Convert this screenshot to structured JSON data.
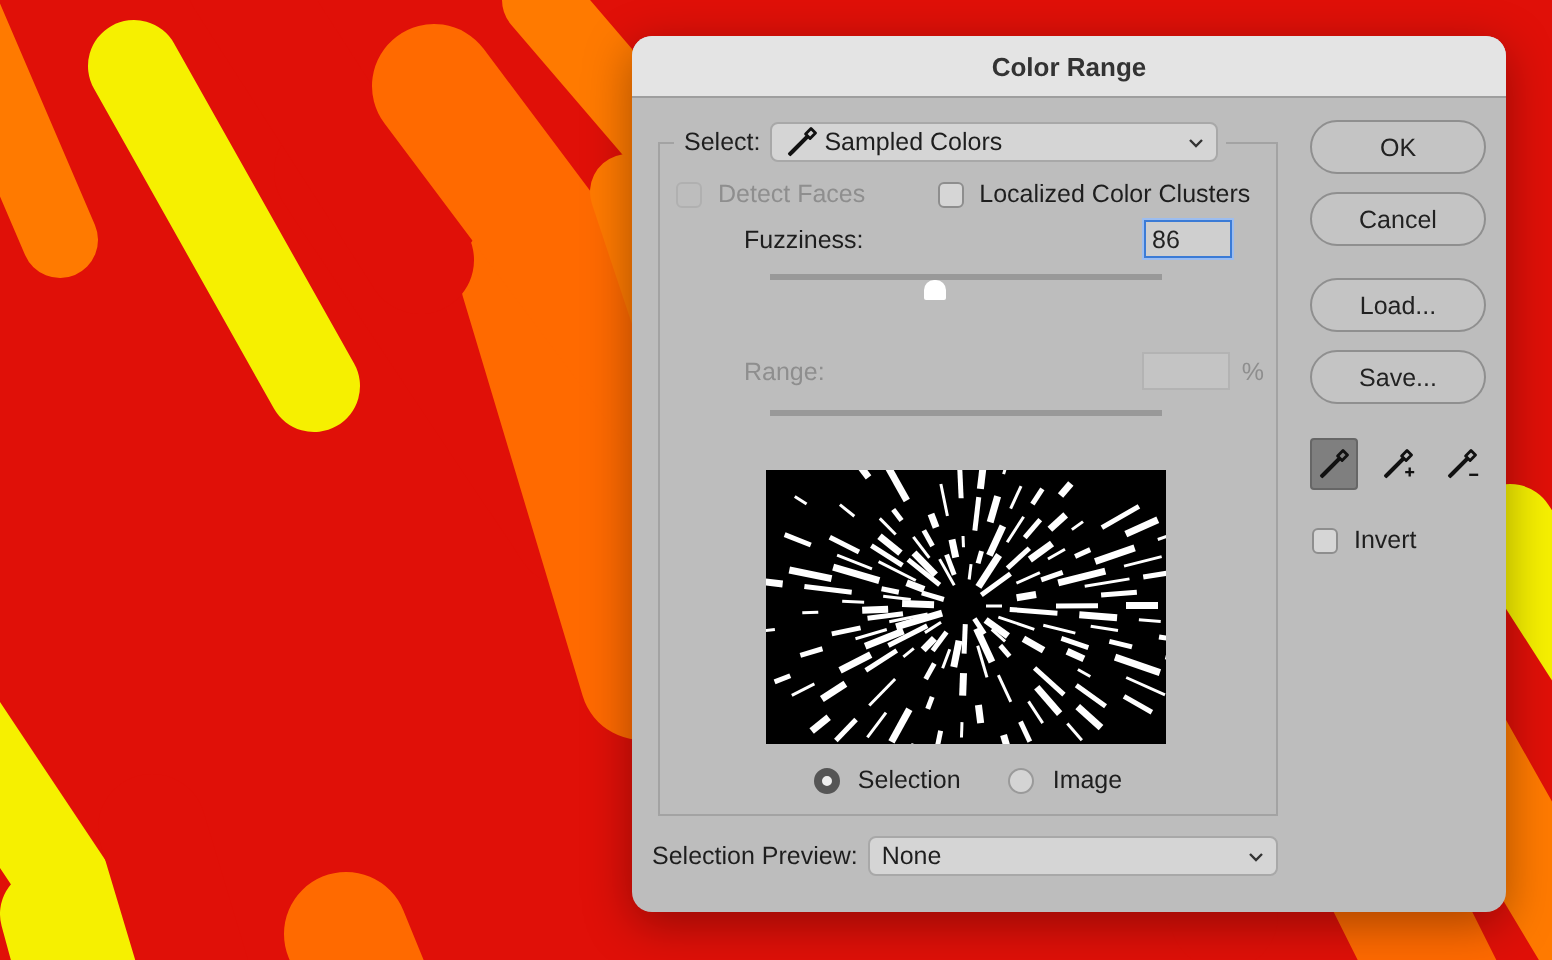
{
  "window": {
    "title": "Color Range"
  },
  "select": {
    "label": "Select:",
    "value": "Sampled Colors"
  },
  "detect_faces": {
    "label": "Detect Faces",
    "checked": false,
    "disabled": true
  },
  "localized_color_clusters": {
    "label": "Localized Color Clusters",
    "checked": false
  },
  "fuzziness": {
    "label": "Fuzziness:",
    "value": "86",
    "level": 0.42
  },
  "range": {
    "label": "Range:",
    "unit": "%",
    "disabled": true
  },
  "preview_modes": [
    {
      "label": "Selection",
      "selected": true
    },
    {
      "label": "Image",
      "selected": false
    }
  ],
  "selection_preview": {
    "label": "Selection Preview:",
    "value": "None"
  },
  "buttons": [
    "OK",
    "Cancel",
    "Load...",
    "Save..."
  ],
  "eyedroppers": [
    {
      "kind": "sample",
      "selected": true
    },
    {
      "kind": "add",
      "selected": false
    },
    {
      "kind": "subtract",
      "selected": false
    }
  ],
  "invert": {
    "label": "Invert",
    "checked": false
  }
}
